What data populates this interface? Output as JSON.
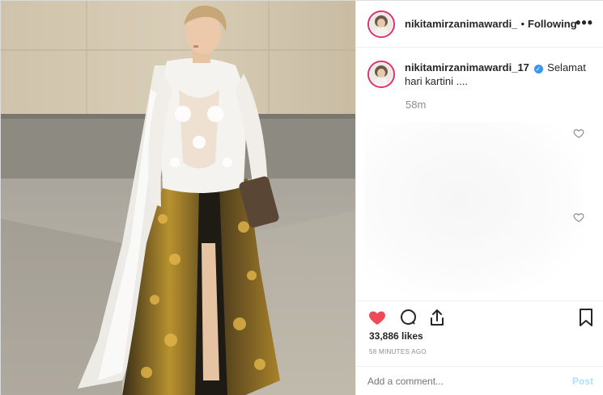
{
  "header": {
    "username": "nikitamirzanimawardi_",
    "separator": "•",
    "follow_status": "Following",
    "more": "•••"
  },
  "caption": {
    "username": "nikitamirzanimawardi_17",
    "verified_mark": "✓",
    "text": "Selamat hari kartini ....",
    "time": "58m"
  },
  "actions": {
    "likes": "33,886 likes",
    "time_ago": "58 MINUTES AGO"
  },
  "comment_box": {
    "placeholder": "Add a comment...",
    "post_label": "Post"
  },
  "colors": {
    "like_red": "#ed4956",
    "verified_blue": "#3897f0",
    "post_disabled": "#b2dffc",
    "muted_text": "#8e8e8e"
  },
  "icons": [
    "heart-filled-icon",
    "comment-icon",
    "share-icon",
    "bookmark-icon",
    "more-icon",
    "verified-icon",
    "comment-heart-icon"
  ]
}
